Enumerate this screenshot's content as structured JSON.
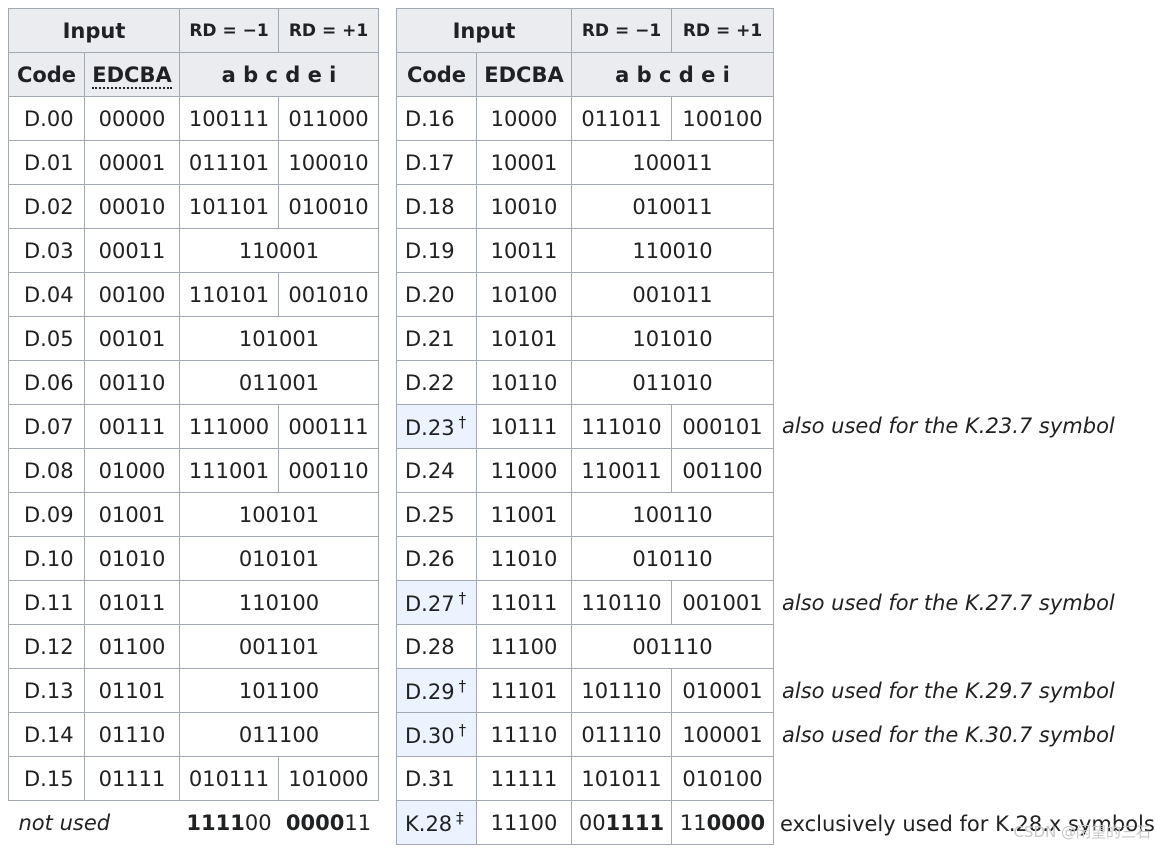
{
  "headers": {
    "input": "Input",
    "rd_minus": "RD = −1",
    "rd_plus": "RD = +1",
    "code": "Code",
    "edcba": "EDCBA",
    "abcdei": "a b c d e i"
  },
  "left_rows": [
    {
      "code": "D.00",
      "edcba": "00000",
      "rd_minus": "100111",
      "rd_plus": "011000"
    },
    {
      "code": "D.01",
      "edcba": "00001",
      "rd_minus": "011101",
      "rd_plus": "100010"
    },
    {
      "code": "D.02",
      "edcba": "00010",
      "rd_minus": "101101",
      "rd_plus": "010010"
    },
    {
      "code": "D.03",
      "edcba": "00011",
      "both": "110001"
    },
    {
      "code": "D.04",
      "edcba": "00100",
      "rd_minus": "110101",
      "rd_plus": "001010"
    },
    {
      "code": "D.05",
      "edcba": "00101",
      "both": "101001"
    },
    {
      "code": "D.06",
      "edcba": "00110",
      "both": "011001"
    },
    {
      "code": "D.07",
      "edcba": "00111",
      "rd_minus": "111000",
      "rd_plus": "000111"
    },
    {
      "code": "D.08",
      "edcba": "01000",
      "rd_minus": "111001",
      "rd_plus": "000110"
    },
    {
      "code": "D.09",
      "edcba": "01001",
      "both": "100101"
    },
    {
      "code": "D.10",
      "edcba": "01010",
      "both": "010101"
    },
    {
      "code": "D.11",
      "edcba": "01011",
      "both": "110100"
    },
    {
      "code": "D.12",
      "edcba": "01100",
      "both": "001101"
    },
    {
      "code": "D.13",
      "edcba": "01101",
      "both": "101100"
    },
    {
      "code": "D.14",
      "edcba": "01110",
      "both": "011100"
    },
    {
      "code": "D.15",
      "edcba": "01111",
      "rd_minus": "010111",
      "rd_plus": "101000"
    }
  ],
  "not_used": {
    "label": "not used",
    "rd_minus_bold": "1111",
    "rd_minus_rest": "00",
    "rd_plus_bold": "0000",
    "rd_plus_rest": "11"
  },
  "right_rows": [
    {
      "code": "D.16",
      "edcba": "10000",
      "rd_minus": "011011",
      "rd_plus": "100100"
    },
    {
      "code": "D.17",
      "edcba": "10001",
      "both": "100011"
    },
    {
      "code": "D.18",
      "edcba": "10010",
      "both": "010011"
    },
    {
      "code": "D.19",
      "edcba": "10011",
      "both": "110010"
    },
    {
      "code": "D.20",
      "edcba": "10100",
      "both": "001011"
    },
    {
      "code": "D.21",
      "edcba": "10101",
      "both": "101010"
    },
    {
      "code": "D.22",
      "edcba": "10110",
      "both": "011010"
    },
    {
      "code": "D.23",
      "mark": "†",
      "edcba": "10111",
      "rd_minus": "111010",
      "rd_plus": "000101"
    },
    {
      "code": "D.24",
      "edcba": "11000",
      "rd_minus": "110011",
      "rd_plus": "001100"
    },
    {
      "code": "D.25",
      "edcba": "11001",
      "both": "100110"
    },
    {
      "code": "D.26",
      "edcba": "11010",
      "both": "010110"
    },
    {
      "code": "D.27",
      "mark": "†",
      "edcba": "11011",
      "rd_minus": "110110",
      "rd_plus": "001001"
    },
    {
      "code": "D.28",
      "edcba": "11100",
      "both": "001110"
    },
    {
      "code": "D.29",
      "mark": "†",
      "edcba": "11101",
      "rd_minus": "101110",
      "rd_plus": "010001"
    },
    {
      "code": "D.30",
      "mark": "†",
      "edcba": "11110",
      "rd_minus": "011110",
      "rd_plus": "100001"
    },
    {
      "code": "D.31",
      "edcba": "11111",
      "rd_minus": "101011",
      "rd_plus": "010100"
    }
  ],
  "k28": {
    "code": "K.28",
    "mark": "‡",
    "edcba": "11100",
    "rd_minus_pre": "00",
    "rd_minus_bold": "1111",
    "rd_plus_pre": "11",
    "rd_plus_bold": "0000"
  },
  "notes": {
    "d23": "also used for the K.23.7 symbol",
    "d27": "also used for the K.27.7 symbol",
    "d29": "also used for the K.29.7 symbol",
    "d30": "also used for the K.30.7 symbol",
    "k28": "exclusively used for K.28.x symbols"
  },
  "watermark": "CSDN @闲望的三石"
}
